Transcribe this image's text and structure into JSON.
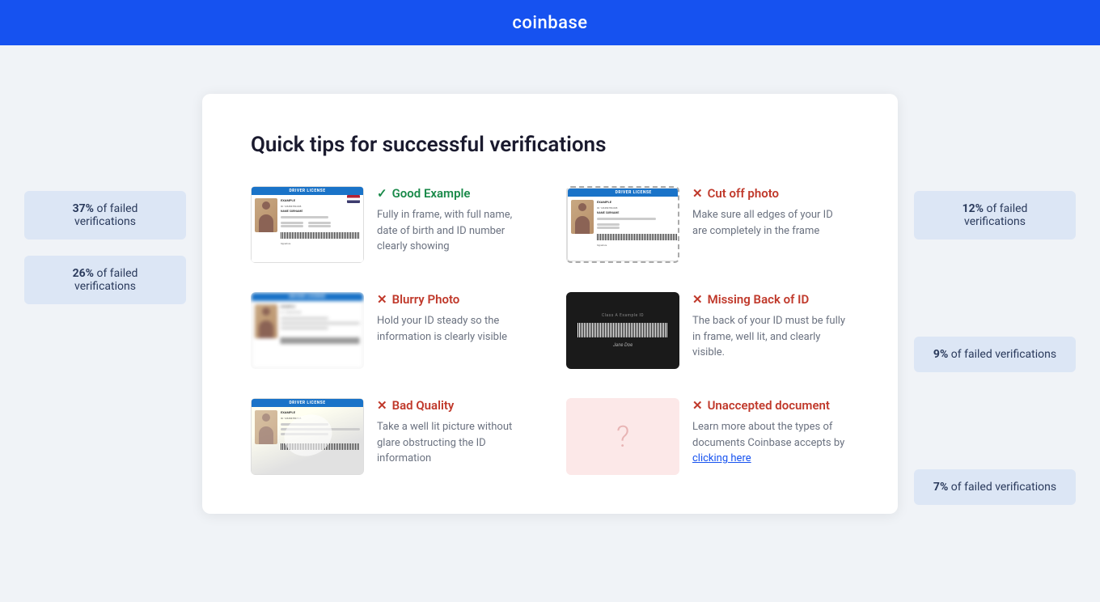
{
  "header": {
    "logo": "coinbase"
  },
  "page": {
    "title": "Quick tips for successful verifications"
  },
  "left_badges": [
    {
      "percent": "37%",
      "label": "of failed verifications"
    },
    {
      "percent": "26%",
      "label": "of failed verifications"
    }
  ],
  "right_badges": [
    {
      "percent": "12%",
      "label": "of failed verifications"
    },
    {
      "percent": "9%",
      "label": "of failed verifications"
    },
    {
      "percent": "7%",
      "label": "of failed verifications"
    }
  ],
  "tips": [
    {
      "id": "good-example",
      "type": "good",
      "icon": "check",
      "label": "Good Example",
      "description": "Fully in frame, with full name, date of birth and ID number clearly showing"
    },
    {
      "id": "cut-off-photo",
      "type": "bad",
      "icon": "x",
      "label": "Cut off photo",
      "description": "Make sure all edges of your ID are completely in the frame"
    },
    {
      "id": "blurry-photo",
      "type": "bad",
      "icon": "x",
      "label": "Blurry Photo",
      "description": "Hold your ID steady so the information is clearly visible"
    },
    {
      "id": "missing-back",
      "type": "bad",
      "icon": "x",
      "label": "Missing Back of ID",
      "description": "The back of your ID must be fully in frame, well lit, and clearly visible."
    },
    {
      "id": "bad-quality",
      "type": "bad",
      "icon": "x",
      "label": "Bad Quality",
      "description": "Take a well lit picture without glare obstructing the ID information"
    },
    {
      "id": "unaccepted-document",
      "type": "bad",
      "icon": "x",
      "label": "Unaccepted document",
      "description": "Learn more about the types of documents Coinbase accepts by",
      "link_text": "clicking here",
      "link_href": "#"
    }
  ]
}
